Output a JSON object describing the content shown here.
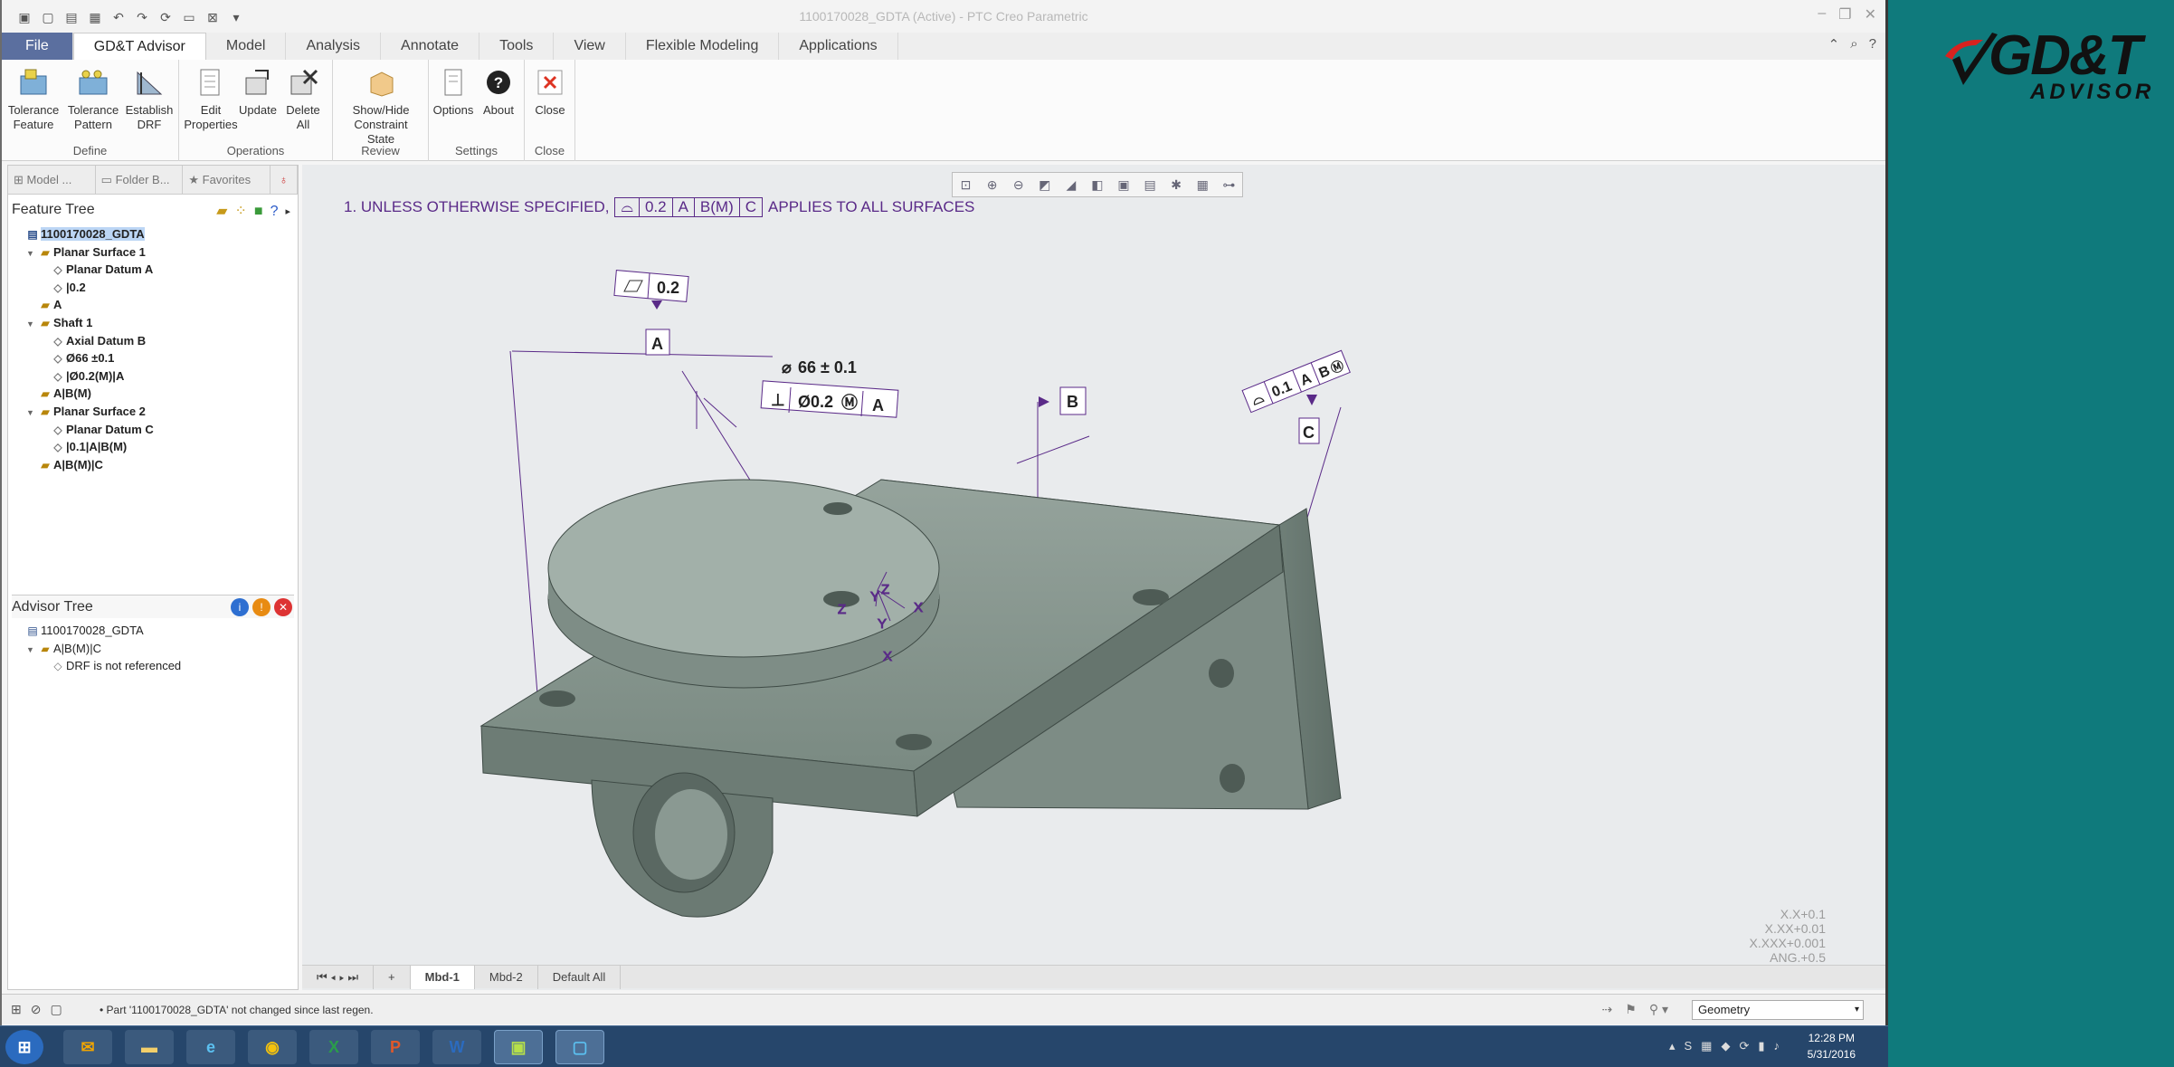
{
  "window": {
    "title": "1100170028_GDTA (Active) - PTC Creo Parametric"
  },
  "tabs": [
    "File",
    "GD&T Advisor",
    "Model",
    "Analysis",
    "Annotate",
    "Tools",
    "View",
    "Flexible Modeling",
    "Applications"
  ],
  "ribbon": {
    "define": {
      "label": "Define",
      "buttons": [
        [
          "Tolerance",
          "Feature"
        ],
        [
          "Tolerance",
          "Pattern"
        ],
        [
          "Establish",
          "DRF"
        ]
      ]
    },
    "operations": {
      "label": "Operations",
      "buttons": [
        [
          "Edit",
          "Properties"
        ],
        [
          "Update",
          ""
        ],
        [
          "Delete",
          "All"
        ]
      ]
    },
    "review": {
      "label": "Review",
      "buttons": [
        [
          "Show/Hide",
          "Constraint State"
        ]
      ]
    },
    "settings": {
      "label": "Settings",
      "buttons": [
        [
          "Options",
          ""
        ],
        [
          "About",
          ""
        ]
      ]
    },
    "close": {
      "label": "Close",
      "buttons": [
        [
          "Close",
          ""
        ]
      ]
    }
  },
  "nav_tabs": [
    "Model ...",
    "Folder B...",
    "Favorites"
  ],
  "feature_tree": {
    "title": "Feature Tree",
    "nodes": [
      {
        "text": "1100170028_GDTA",
        "level": 0,
        "bold": true
      },
      {
        "text": "Planar Surface 1",
        "level": 1,
        "bold": true,
        "expand": true
      },
      {
        "text": "Planar Datum A",
        "level": 2,
        "bold": true
      },
      {
        "text": "|0.2",
        "level": 2,
        "bold": true
      },
      {
        "text": "A",
        "level": 1,
        "bold": true
      },
      {
        "text": "Shaft 1",
        "level": 1,
        "bold": true,
        "expand": true
      },
      {
        "text": "Axial Datum B",
        "level": 2,
        "bold": true
      },
      {
        "text": "Ø66 ±0.1",
        "level": 2,
        "bold": true
      },
      {
        "text": "|Ø0.2(M)|A",
        "level": 2,
        "bold": true
      },
      {
        "text": "A|B(M)",
        "level": 1,
        "bold": true
      },
      {
        "text": "Planar Surface 2",
        "level": 1,
        "bold": true,
        "expand": true
      },
      {
        "text": "Planar Datum C",
        "level": 2,
        "bold": true
      },
      {
        "text": "|0.1|A|B(M)",
        "level": 2,
        "bold": true
      },
      {
        "text": "A|B(M)|C",
        "level": 1,
        "bold": true
      }
    ]
  },
  "advisor_tree": {
    "title": "Advisor Tree",
    "nodes": [
      {
        "text": "1100170028_GDTA",
        "level": 0,
        "bold": false
      },
      {
        "text": "A|B(M)|C",
        "level": 1,
        "bold": false,
        "expand": true
      },
      {
        "text": "DRF is not referenced",
        "level": 2,
        "bold": false
      }
    ]
  },
  "canvas": {
    "note_prefix": "1. UNLESS OTHERWISE SPECIFIED,",
    "note_fcf": [
      "0.2",
      "A",
      "B(M)",
      "C"
    ],
    "note_suffix": "APPLIES TO ALL SURFACES",
    "annot": {
      "flat_val": "0.2",
      "datum_a": "A",
      "dim": "66 ± 0.1",
      "pos_val": "Ø0.2",
      "pos_ref": "A",
      "datum_b": "B",
      "prof_val": "0.1",
      "prof_refs": [
        "A",
        "B"
      ],
      "datum_c": "C"
    },
    "axes": {
      "x": "X",
      "y": "Y",
      "z": "Z"
    },
    "tolerances": [
      "X.X+0.1",
      "X.XX+0.01",
      "X.XXX+0.001",
      "ANG.+0.5"
    ]
  },
  "bottom_tabs": [
    "Mbd-1",
    "Mbd-2",
    "Default All"
  ],
  "status": {
    "message": "Part '1100170028_GDTA' not changed since last regen.",
    "filter": "Geometry"
  },
  "clock": {
    "time": "12:28 PM",
    "date": "5/31/2016"
  },
  "brand": {
    "main": "GD&T",
    "sub": "ADVISOR"
  },
  "colors": {
    "accent": "#5b6f9f",
    "annotation": "#5a2a88",
    "model": "#7f8e86",
    "background": "#0f7a7c"
  }
}
